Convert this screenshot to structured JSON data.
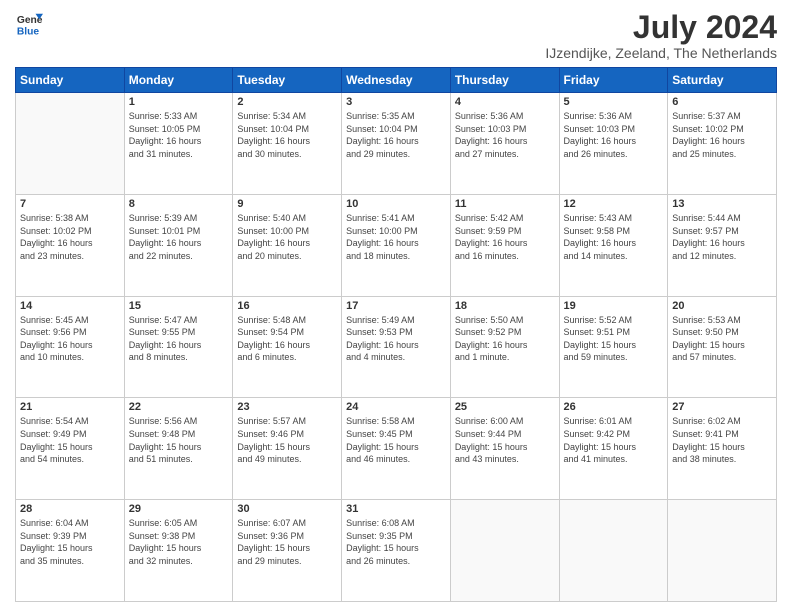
{
  "header": {
    "logo_line1": "General",
    "logo_line2": "Blue",
    "month": "July 2024",
    "location": "IJzendijke, Zeeland, The Netherlands"
  },
  "weekdays": [
    "Sunday",
    "Monday",
    "Tuesday",
    "Wednesday",
    "Thursday",
    "Friday",
    "Saturday"
  ],
  "weeks": [
    [
      {
        "day": "",
        "detail": ""
      },
      {
        "day": "1",
        "detail": "Sunrise: 5:33 AM\nSunset: 10:05 PM\nDaylight: 16 hours\nand 31 minutes."
      },
      {
        "day": "2",
        "detail": "Sunrise: 5:34 AM\nSunset: 10:04 PM\nDaylight: 16 hours\nand 30 minutes."
      },
      {
        "day": "3",
        "detail": "Sunrise: 5:35 AM\nSunset: 10:04 PM\nDaylight: 16 hours\nand 29 minutes."
      },
      {
        "day": "4",
        "detail": "Sunrise: 5:36 AM\nSunset: 10:03 PM\nDaylight: 16 hours\nand 27 minutes."
      },
      {
        "day": "5",
        "detail": "Sunrise: 5:36 AM\nSunset: 10:03 PM\nDaylight: 16 hours\nand 26 minutes."
      },
      {
        "day": "6",
        "detail": "Sunrise: 5:37 AM\nSunset: 10:02 PM\nDaylight: 16 hours\nand 25 minutes."
      }
    ],
    [
      {
        "day": "7",
        "detail": "Sunrise: 5:38 AM\nSunset: 10:02 PM\nDaylight: 16 hours\nand 23 minutes."
      },
      {
        "day": "8",
        "detail": "Sunrise: 5:39 AM\nSunset: 10:01 PM\nDaylight: 16 hours\nand 22 minutes."
      },
      {
        "day": "9",
        "detail": "Sunrise: 5:40 AM\nSunset: 10:00 PM\nDaylight: 16 hours\nand 20 minutes."
      },
      {
        "day": "10",
        "detail": "Sunrise: 5:41 AM\nSunset: 10:00 PM\nDaylight: 16 hours\nand 18 minutes."
      },
      {
        "day": "11",
        "detail": "Sunrise: 5:42 AM\nSunset: 9:59 PM\nDaylight: 16 hours\nand 16 minutes."
      },
      {
        "day": "12",
        "detail": "Sunrise: 5:43 AM\nSunset: 9:58 PM\nDaylight: 16 hours\nand 14 minutes."
      },
      {
        "day": "13",
        "detail": "Sunrise: 5:44 AM\nSunset: 9:57 PM\nDaylight: 16 hours\nand 12 minutes."
      }
    ],
    [
      {
        "day": "14",
        "detail": "Sunrise: 5:45 AM\nSunset: 9:56 PM\nDaylight: 16 hours\nand 10 minutes."
      },
      {
        "day": "15",
        "detail": "Sunrise: 5:47 AM\nSunset: 9:55 PM\nDaylight: 16 hours\nand 8 minutes."
      },
      {
        "day": "16",
        "detail": "Sunrise: 5:48 AM\nSunset: 9:54 PM\nDaylight: 16 hours\nand 6 minutes."
      },
      {
        "day": "17",
        "detail": "Sunrise: 5:49 AM\nSunset: 9:53 PM\nDaylight: 16 hours\nand 4 minutes."
      },
      {
        "day": "18",
        "detail": "Sunrise: 5:50 AM\nSunset: 9:52 PM\nDaylight: 16 hours\nand 1 minute."
      },
      {
        "day": "19",
        "detail": "Sunrise: 5:52 AM\nSunset: 9:51 PM\nDaylight: 15 hours\nand 59 minutes."
      },
      {
        "day": "20",
        "detail": "Sunrise: 5:53 AM\nSunset: 9:50 PM\nDaylight: 15 hours\nand 57 minutes."
      }
    ],
    [
      {
        "day": "21",
        "detail": "Sunrise: 5:54 AM\nSunset: 9:49 PM\nDaylight: 15 hours\nand 54 minutes."
      },
      {
        "day": "22",
        "detail": "Sunrise: 5:56 AM\nSunset: 9:48 PM\nDaylight: 15 hours\nand 51 minutes."
      },
      {
        "day": "23",
        "detail": "Sunrise: 5:57 AM\nSunset: 9:46 PM\nDaylight: 15 hours\nand 49 minutes."
      },
      {
        "day": "24",
        "detail": "Sunrise: 5:58 AM\nSunset: 9:45 PM\nDaylight: 15 hours\nand 46 minutes."
      },
      {
        "day": "25",
        "detail": "Sunrise: 6:00 AM\nSunset: 9:44 PM\nDaylight: 15 hours\nand 43 minutes."
      },
      {
        "day": "26",
        "detail": "Sunrise: 6:01 AM\nSunset: 9:42 PM\nDaylight: 15 hours\nand 41 minutes."
      },
      {
        "day": "27",
        "detail": "Sunrise: 6:02 AM\nSunset: 9:41 PM\nDaylight: 15 hours\nand 38 minutes."
      }
    ],
    [
      {
        "day": "28",
        "detail": "Sunrise: 6:04 AM\nSunset: 9:39 PM\nDaylight: 15 hours\nand 35 minutes."
      },
      {
        "day": "29",
        "detail": "Sunrise: 6:05 AM\nSunset: 9:38 PM\nDaylight: 15 hours\nand 32 minutes."
      },
      {
        "day": "30",
        "detail": "Sunrise: 6:07 AM\nSunset: 9:36 PM\nDaylight: 15 hours\nand 29 minutes."
      },
      {
        "day": "31",
        "detail": "Sunrise: 6:08 AM\nSunset: 9:35 PM\nDaylight: 15 hours\nand 26 minutes."
      },
      {
        "day": "",
        "detail": ""
      },
      {
        "day": "",
        "detail": ""
      },
      {
        "day": "",
        "detail": ""
      }
    ]
  ]
}
